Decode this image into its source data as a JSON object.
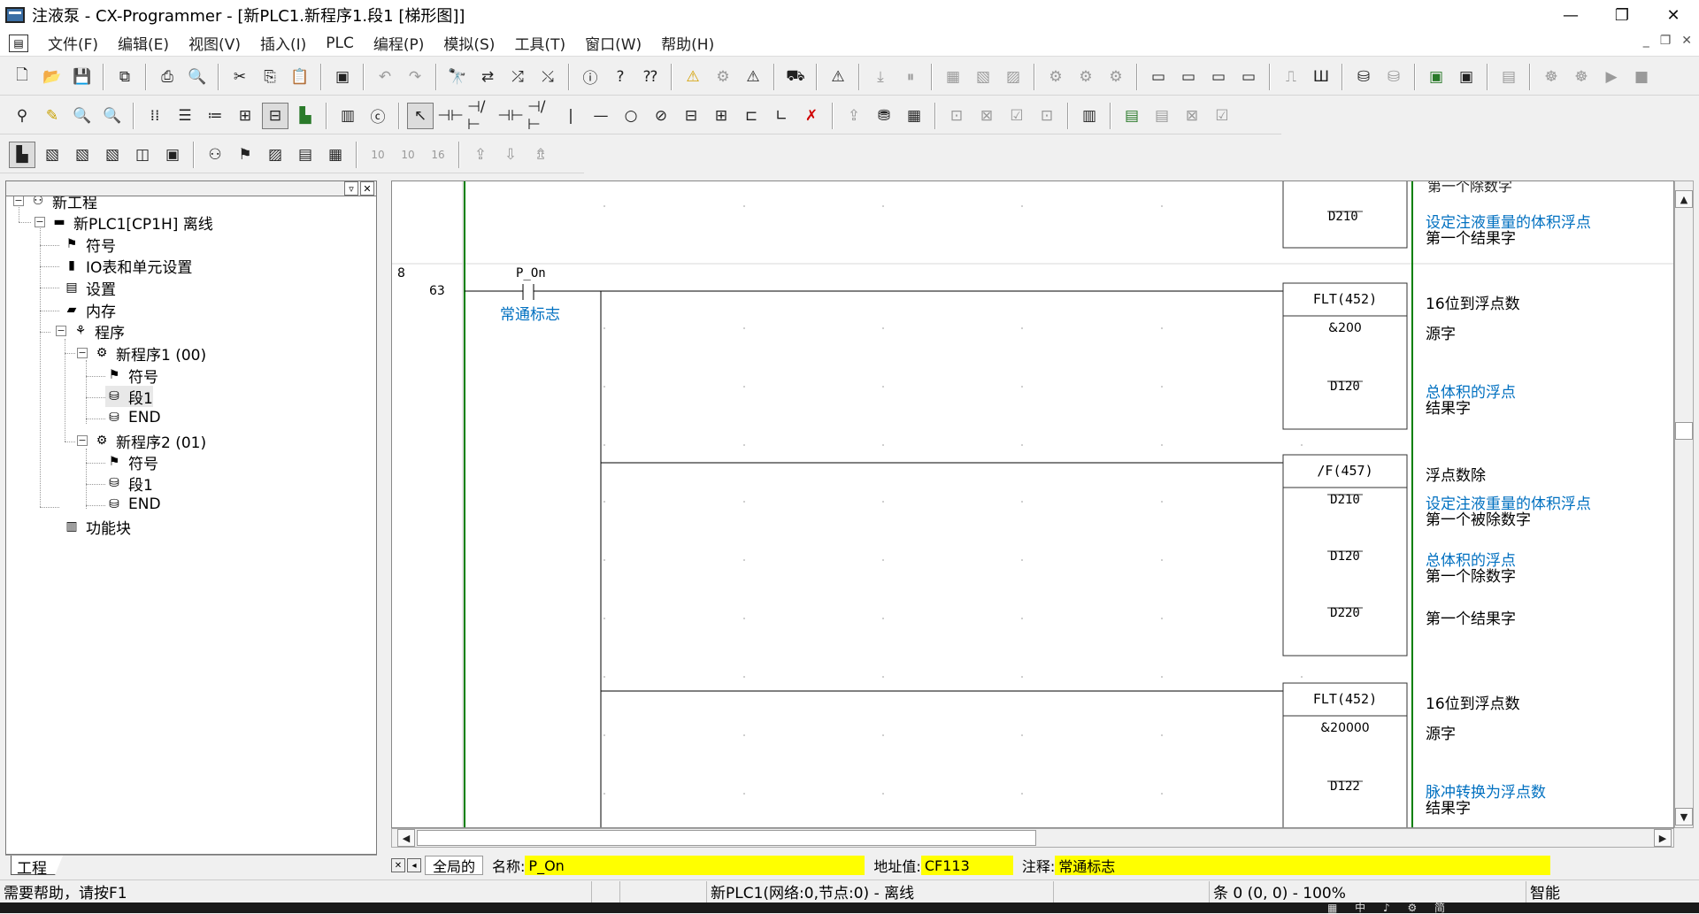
{
  "window": {
    "title": "注液泵 - CX-Programmer - [新PLC1.新程序1.段1 [梯形图]]",
    "minimize": "—",
    "maximize": "❐",
    "close": "✕"
  },
  "menu": {
    "items": [
      "文件(F)",
      "编辑(E)",
      "视图(V)",
      "插入(I)",
      "PLC",
      "编程(P)",
      "模拟(S)",
      "工具(T)",
      "窗口(W)",
      "帮助(H)"
    ],
    "mdi_min": "_",
    "mdi_restore": "❐",
    "mdi_close": "✕"
  },
  "toolbar1": {
    "icons": [
      "new-icon",
      "open-icon",
      "save-icon",
      "compare-icon",
      "print-icon",
      "print-preview-icon",
      "cut-icon",
      "copy-icon",
      "paste-icon",
      "clipboard-icon",
      "undo-icon",
      "redo-icon",
      "find-icon",
      "replace-icon",
      "cross-ref-icon",
      "address-ref-icon",
      "about-icon",
      "help-icon",
      "context-help-icon",
      "warning-icon",
      "online-icon",
      "monitor-icon",
      "transfer-icon",
      "upload-icon"
    ]
  },
  "toolbar3": {
    "n10a": "10",
    "n10b": "10",
    "n16": "16"
  },
  "project_tree": {
    "root": "新工程",
    "plc": "新PLC1[CP1H] 离线",
    "symbols": "符号",
    "io_table": "IO表和单元设置",
    "settings": "设置",
    "memory": "内存",
    "programs": "程序",
    "prog1": "新程序1 (00)",
    "prog1_symbols": "符号",
    "prog1_section": "段1",
    "prog1_end": "END",
    "prog2": "新程序2 (01)",
    "prog2_symbols": "符号",
    "prog2_section": "段1",
    "prog2_end": "END",
    "function_blocks": "功能块",
    "tab": "工程"
  },
  "ladder": {
    "partial_comment_top": "第一个除数字",
    "block0_operand": "D210",
    "block0_comment_blue": "设定注液重量的体积浮点",
    "block0_comment": "第一个结果字",
    "rung_number": "8",
    "step_number": "63",
    "contact_name": "P_On",
    "contact_comment": "常通标志",
    "instr1": {
      "name": "FLT(452)",
      "desc": "16位到浮点数",
      "op1": "&200",
      "op1_label": "源字",
      "op2": "D120",
      "op2_blue": "总体积的浮点",
      "op2_label": "结果字"
    },
    "instr2": {
      "name": "/F(457)",
      "desc": "浮点数除",
      "op1": "D210",
      "op1_blue": "设定注液重量的体积浮点",
      "op1_label": "第一个被除数字",
      "op2": "D120",
      "op2_blue": "总体积的浮点",
      "op2_label": "第一个除数字",
      "op3": "D220",
      "op3_label": "第一个结果字"
    },
    "instr3": {
      "name": "FLT(452)",
      "desc": "16位到浮点数",
      "op1": "&20000",
      "op1_label": "源字",
      "op2": "D122",
      "op2_blue": "脉冲转换为浮点数",
      "op2_label": "结果字"
    }
  },
  "infobar": {
    "global": "全局的",
    "name_label": "名称:",
    "name_value": "P_On",
    "address_label": "地址值:",
    "address_value": "CF113",
    "comment_label": "注释:",
    "comment_value": "常通标志"
  },
  "statusbar": {
    "help": "需要帮助，请按F1",
    "plc_status": "新PLC1(网络:0,节点:0) - 离线",
    "position": "条 0 (0, 0)  - 100%",
    "mode": "智能"
  },
  "colors": {
    "comment_blue": "#0070c0",
    "info_yellow": "#ffff00",
    "power_rail": "#008000"
  }
}
